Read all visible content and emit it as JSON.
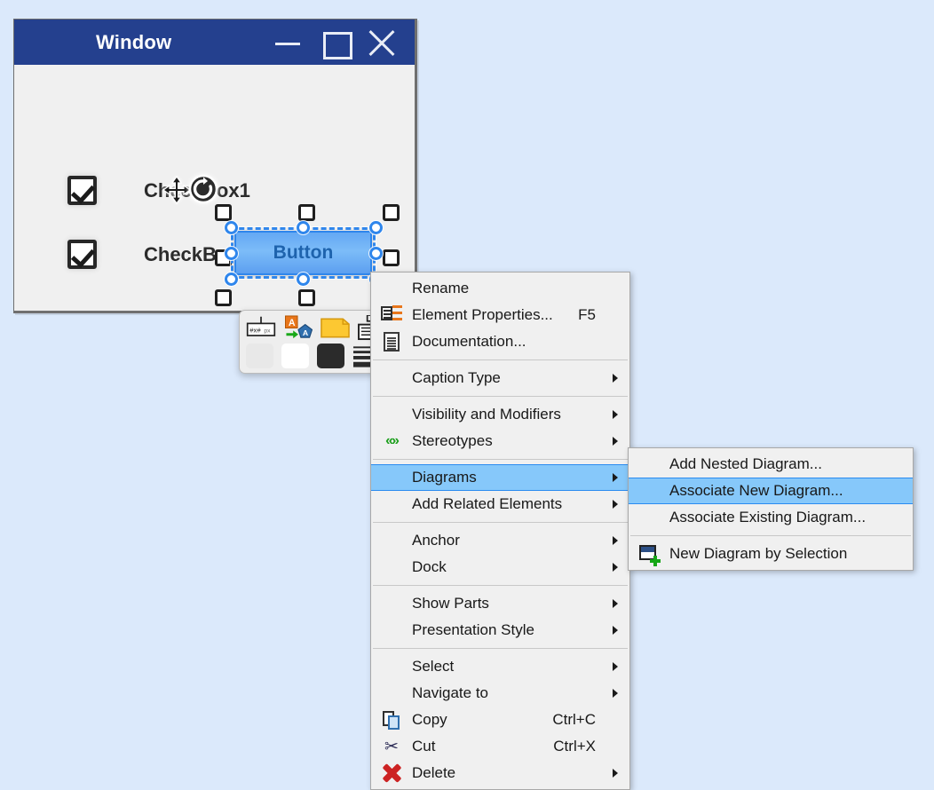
{
  "canvas": {
    "background_color": "#dbe9fb"
  },
  "mock_window": {
    "title": "Window",
    "titlebar_color": "#24408e",
    "controls": [
      {
        "name": "minimize",
        "glyph": "minimize-icon"
      },
      {
        "name": "maximize",
        "glyph": "maximize-icon"
      },
      {
        "name": "close",
        "glyph": "close-icon"
      }
    ],
    "checkboxes": [
      {
        "label": "CheckBox1",
        "checked": true
      },
      {
        "label": "CheckBox2",
        "checked": true
      }
    ],
    "selected_shape": {
      "label": "Button",
      "fill_color": "#6fb0f5",
      "border_color": "#2f86ec"
    },
    "cursor_overlays": [
      {
        "name": "move-cursor"
      },
      {
        "name": "rotate-handle"
      }
    ]
  },
  "format_toolbar": {
    "row1": [
      {
        "name": "size-px-icon",
        "label": "#x# px"
      },
      {
        "name": "convert-shape-icon",
        "label": ""
      },
      {
        "name": "note-shape-icon",
        "label": ""
      },
      {
        "name": "frame-icon",
        "label": ""
      }
    ],
    "row2": [
      {
        "name": "fill-color-light-swatch",
        "color": "#e8e8e8"
      },
      {
        "name": "fill-color-white-swatch",
        "color": "#ffffff"
      },
      {
        "name": "fill-color-dark-swatch",
        "color": "#2b2b2b"
      },
      {
        "name": "line-weight-icon",
        "color": "#2b2b2b"
      }
    ]
  },
  "context_menu": {
    "highlight_color": "#86c8fa",
    "highlight_border": "#2a8bf0",
    "items": [
      {
        "label": "Rename",
        "icon": "none",
        "accel": "",
        "arrow": false,
        "selected": false
      },
      {
        "label": "Element Properties...",
        "icon": "properties",
        "accel": "F5",
        "arrow": false,
        "selected": false
      },
      {
        "label": "Documentation...",
        "icon": "document",
        "accel": "",
        "arrow": false,
        "selected": false
      },
      {
        "separator": true
      },
      {
        "label": "Caption Type",
        "icon": "none",
        "accel": "",
        "arrow": true,
        "selected": false
      },
      {
        "separator": true
      },
      {
        "label": "Visibility and Modifiers",
        "icon": "none",
        "accel": "",
        "arrow": true,
        "selected": false
      },
      {
        "label": "Stereotypes",
        "icon": "stereotypes",
        "accel": "",
        "arrow": true,
        "selected": false
      },
      {
        "separator": true
      },
      {
        "label": "Diagrams",
        "icon": "none",
        "accel": "",
        "arrow": true,
        "selected": true
      },
      {
        "label": "Add Related Elements",
        "icon": "none",
        "accel": "",
        "arrow": true,
        "selected": false
      },
      {
        "separator": true
      },
      {
        "label": "Anchor",
        "icon": "none",
        "accel": "",
        "arrow": true,
        "selected": false
      },
      {
        "label": "Dock",
        "icon": "none",
        "accel": "",
        "arrow": true,
        "selected": false
      },
      {
        "separator": true
      },
      {
        "label": "Show Parts",
        "icon": "none",
        "accel": "",
        "arrow": true,
        "selected": false
      },
      {
        "label": "Presentation Style",
        "icon": "none",
        "accel": "",
        "arrow": true,
        "selected": false
      },
      {
        "separator": true
      },
      {
        "label": "Select",
        "icon": "none",
        "accel": "",
        "arrow": true,
        "selected": false
      },
      {
        "label": "Navigate to",
        "icon": "none",
        "accel": "",
        "arrow": true,
        "selected": false
      },
      {
        "label": "Copy",
        "icon": "copy",
        "accel": "Ctrl+C",
        "arrow": false,
        "selected": false
      },
      {
        "label": "Cut",
        "icon": "cut",
        "accel": "Ctrl+X",
        "arrow": false,
        "selected": false
      },
      {
        "label": "Delete",
        "icon": "delete",
        "accel": "",
        "arrow": true,
        "selected": false
      }
    ]
  },
  "submenu": {
    "items": [
      {
        "label": "Add Nested Diagram...",
        "icon": "none",
        "arrow": false,
        "selected": false
      },
      {
        "label": "Associate New Diagram...",
        "icon": "none",
        "arrow": false,
        "selected": true
      },
      {
        "label": "Associate Existing Diagram...",
        "icon": "none",
        "arrow": false,
        "selected": false
      },
      {
        "separator": true
      },
      {
        "label": "New Diagram by Selection",
        "icon": "newdiag",
        "arrow": false,
        "selected": false
      }
    ]
  }
}
